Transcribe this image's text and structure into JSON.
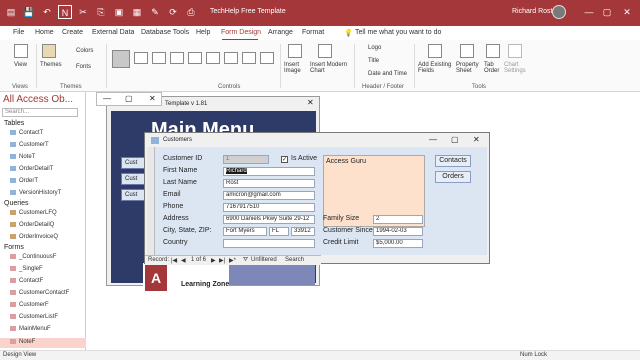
{
  "app": {
    "window_title": "TechHelp Free Template",
    "user_name": "Richard Rost",
    "colors": {
      "accent": "#a4373a",
      "form_bg": "#dce6f2",
      "main_menu_bg": "#2e3a68",
      "notes_bg": "#fde1cc"
    }
  },
  "quick_access": {
    "icons": [
      "views-icon",
      "save-icon",
      "undo-icon",
      "home-grid-icon",
      "cut-icon",
      "copy-icon",
      "paste-icon",
      "table-icon",
      "design-icon",
      "refresh-icon",
      "print-icon",
      "arrow-icon",
      "repeat-icon"
    ]
  },
  "window_controls": {
    "minimize": "—",
    "maximize": "▢",
    "close": "✕"
  },
  "menu": {
    "items": [
      "File",
      "Home",
      "Create",
      "External Data",
      "Database Tools",
      "Help",
      "Form Design",
      "Arrange",
      "Format"
    ],
    "active": "Form Design",
    "tell_me": "Tell me what you want to do"
  },
  "ribbon": {
    "views_label": "View",
    "views_group": "Views",
    "themes_label": "Themes",
    "colors_label": "Colors",
    "fonts_label": "Fonts",
    "themes_group": "Themes",
    "controls_group": "Controls",
    "insert_image": "Insert Image",
    "insert_chart": "Insert Modern Chart",
    "logo": "Logo",
    "title": "Title",
    "date_time": "Date and Time",
    "header_footer_group": "Header / Footer",
    "add_fields": "Add Existing Fields",
    "property_sheet": "Property Sheet",
    "tab_order": "Tab Order",
    "chart_settings": "Chart Settings",
    "tools_group": "Tools"
  },
  "nav": {
    "title": "All Access Ob...",
    "search_placeholder": "Search...",
    "categories": {
      "tables": "Tables",
      "queries": "Queries",
      "forms": "Forms"
    },
    "tables": [
      "ContactT",
      "CustomerT",
      "NoteT",
      "OrderDetailT",
      "OrderT",
      "VersionHistoryT"
    ],
    "queries": [
      "CustomerLFQ",
      "OrderDetailQ",
      "OrderInvoiceQ"
    ],
    "forms": [
      "_ContinuousF",
      "_SingleF",
      "ContactF",
      "CustomerContactF",
      "CustomerF",
      "CustomerListF",
      "MainMenuF",
      "NoteF"
    ]
  },
  "main_menu_window": {
    "title": "Template v 1.81",
    "heading": "Main Menu",
    "buttons": [
      "Cust",
      "Cust",
      "Cust"
    ],
    "logo_text": "Learning Zone",
    "logo_mark": "A"
  },
  "customers": {
    "title": "Customers",
    "labels": {
      "id": "Customer ID",
      "first": "First Name",
      "last": "Last Name",
      "email": "Email",
      "phone": "Phone",
      "address": "Address",
      "city": "City, State, ZIP:",
      "country": "Country",
      "is_active": "Is Active",
      "family_size": "Family Size",
      "customer_since": "Customer Since",
      "credit_limit": "Credit Limit"
    },
    "values": {
      "id": "1",
      "first": "Richard",
      "last": "Rost",
      "email": "amicron@gmail.com",
      "phone": "7167917510",
      "address": "6900 Daniels Pkwy Suite 29-12",
      "city": "Fort Myers",
      "state": "FL",
      "zip": "33912",
      "country": "",
      "is_active": "✓",
      "family_size": "2",
      "customer_since": "1994-02-03",
      "credit_limit": "$5,000.00",
      "notes": "Access Guru"
    },
    "buttons": {
      "contacts": "Contacts",
      "orders": "Orders"
    },
    "record_nav": {
      "record_label": "Record:",
      "position": "1 of 6",
      "filter": "Unfiltered",
      "search": "Search"
    }
  },
  "status": {
    "left": "Design View",
    "right": "Num Lock"
  }
}
